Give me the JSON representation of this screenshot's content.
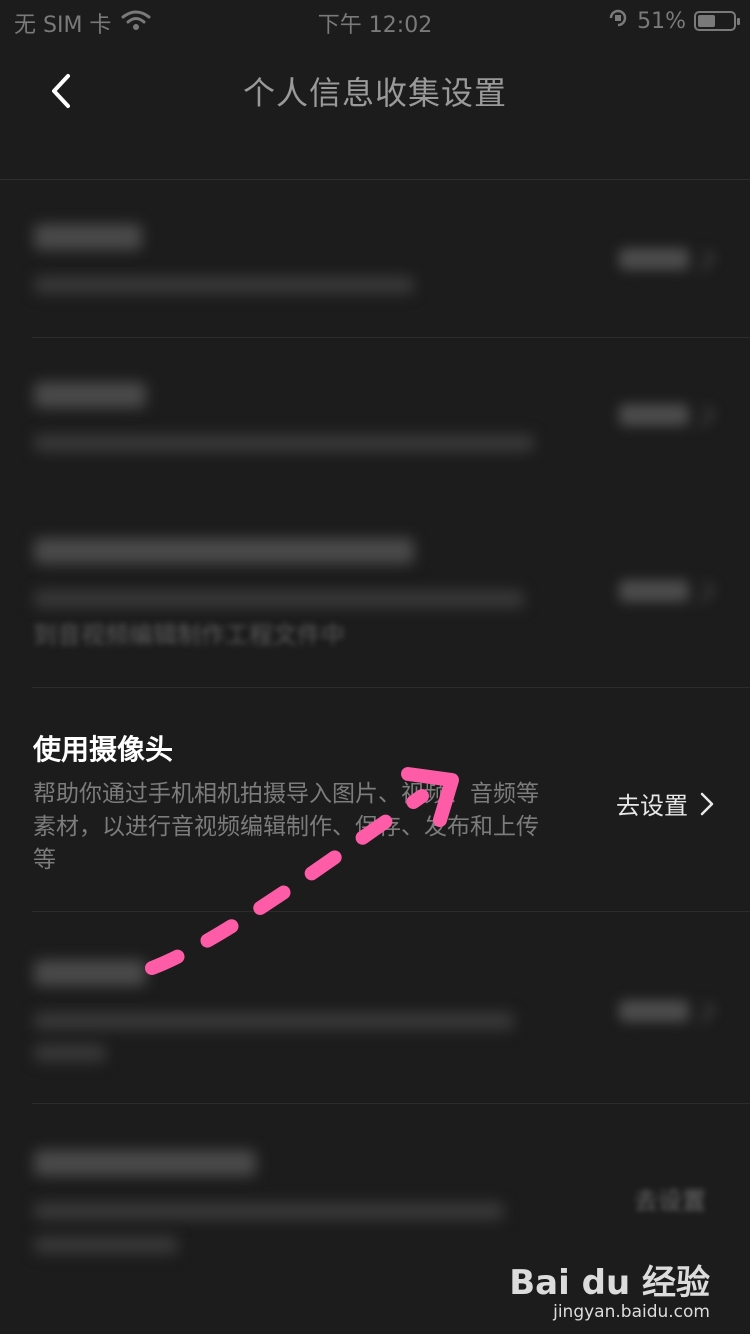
{
  "status_bar": {
    "carrier": "无 SIM 卡",
    "time": "下午 12:02",
    "battery_percent": "51%",
    "battery_level": 0.51,
    "icons": [
      "wifi-icon",
      "orientation-lock-icon",
      "battery-icon"
    ]
  },
  "nav": {
    "back_icon": "chevron-left-icon",
    "title": "个人信息收集设置"
  },
  "settings": {
    "visible_item": {
      "title": "使用摄像头",
      "description": "帮助你通过手机相机拍摄导入图片、视频、音频等素材，以进行音视频编辑制作、保存、发布和上传等",
      "action_label": "去设置",
      "action_icon": "chevron-right-icon"
    },
    "blurred_fragments": {
      "item3_line2": "到音视频编辑制作工程文件中",
      "item6_action": "去设置"
    }
  },
  "annotation": {
    "arrow_color": "#ff5ca8",
    "arrow_icon": "dashed-arrow"
  },
  "watermark": {
    "logo": "Bai du 经验",
    "url": "jingyan.baidu.com"
  },
  "colors": {
    "background": "#1c1c1c",
    "title_text": "#9a9a9a",
    "desc_text": "#7c7c7c",
    "arrow": "#ff5ca8"
  }
}
